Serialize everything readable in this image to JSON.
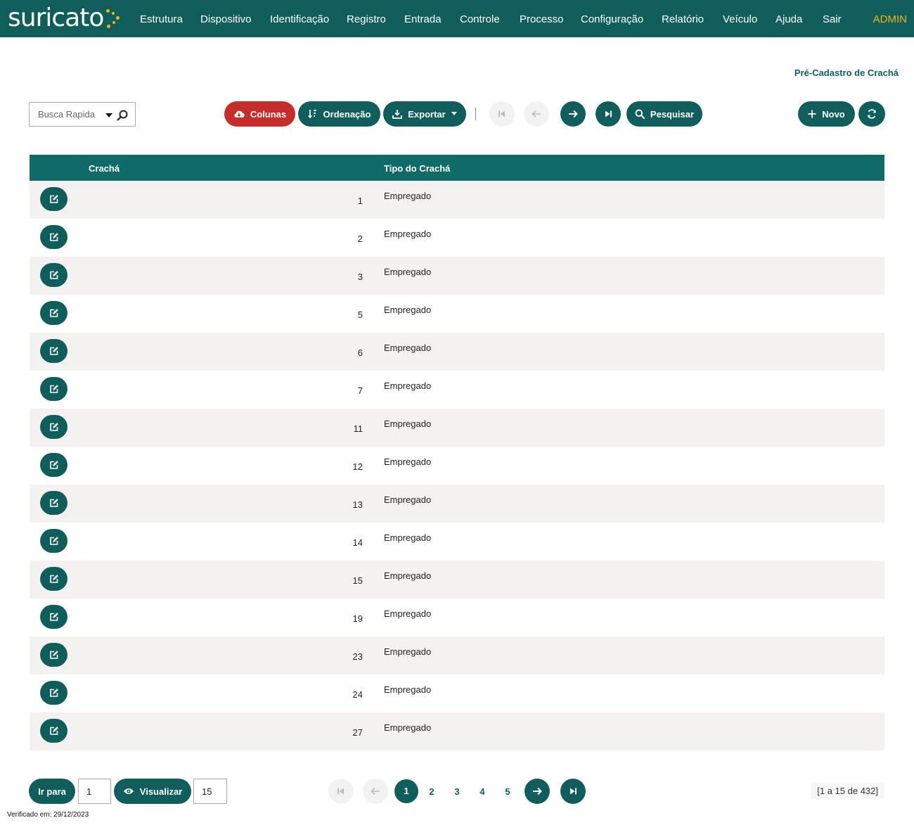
{
  "brand": {
    "name": "suricato"
  },
  "nav": {
    "items": [
      "Estrutura",
      "Dispositivo",
      "Identificação",
      "Registro",
      "Entrada",
      "Controle",
      "Processo",
      "Configuração",
      "Relatório",
      "Veículo",
      "Ajuda",
      "Sair"
    ],
    "user": "ADMIN"
  },
  "page": {
    "title": "Pré-Cadastro de Crachá"
  },
  "toolbar": {
    "search_placeholder": "Busca Rapida",
    "columns_label": "Colunas",
    "sort_label": "Ordenação",
    "export_label": "Exportar",
    "search_label": "Pesquisar",
    "new_label": "Novo"
  },
  "table": {
    "headers": {
      "badge": "Crachá",
      "type": "Tipo do Crachá"
    },
    "rows": [
      {
        "badge": "1",
        "type": "Empregado"
      },
      {
        "badge": "2",
        "type": "Empregado"
      },
      {
        "badge": "3",
        "type": "Empregado"
      },
      {
        "badge": "5",
        "type": "Empregado"
      },
      {
        "badge": "6",
        "type": "Empregado"
      },
      {
        "badge": "7",
        "type": "Empregado"
      },
      {
        "badge": "11",
        "type": "Empregado"
      },
      {
        "badge": "12",
        "type": "Empregado"
      },
      {
        "badge": "13",
        "type": "Empregado"
      },
      {
        "badge": "14",
        "type": "Empregado"
      },
      {
        "badge": "15",
        "type": "Empregado"
      },
      {
        "badge": "19",
        "type": "Empregado"
      },
      {
        "badge": "23",
        "type": "Empregado"
      },
      {
        "badge": "24",
        "type": "Empregado"
      },
      {
        "badge": "27",
        "type": "Empregado"
      }
    ]
  },
  "pagination": {
    "goto_label": "Ir para",
    "goto_value": "1",
    "view_label": "Visualizar",
    "view_value": "15",
    "pages": [
      "1",
      "2",
      "3",
      "4",
      "5"
    ],
    "current_page": "1",
    "record_count": "[1 a 15 de 432]"
  },
  "footer": {
    "verified": "Verificado em: 29/12/2023"
  },
  "colors": {
    "primary": "#0f5e5c",
    "danger": "#c62d28",
    "accent": "#f4b21c",
    "row_alt": "#f4f1f0"
  }
}
